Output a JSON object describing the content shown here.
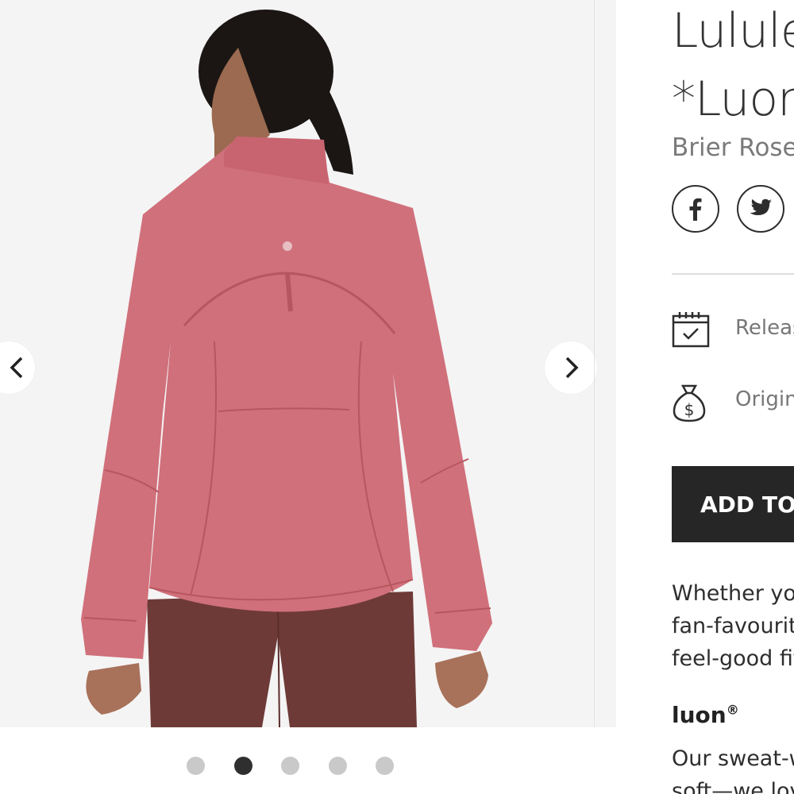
{
  "product": {
    "title_line1": "Lululemon",
    "title_line2": "*Luon",
    "color_name": "Brier Rose"
  },
  "social": {
    "facebook_icon": "facebook-icon",
    "twitter_icon": "twitter-icon"
  },
  "info": {
    "release_label": "Release",
    "original_label": "Original"
  },
  "cart": {
    "add_label": "ADD TO"
  },
  "description": {
    "lines": [
      "Whether you",
      "fan-favourite",
      "feel-good fit"
    ]
  },
  "fabric": {
    "heading": "luon",
    "heading_mark": "®",
    "lines": [
      "Our sweat-w",
      "soft—we lov"
    ]
  },
  "gallery": {
    "total_images": 5,
    "active_index": 1,
    "prev_icon": "chevron-left-icon",
    "next_icon": "chevron-right-icon"
  },
  "colors": {
    "jacket": "#d0707b",
    "leggings": "#6e3a37",
    "button_bg": "#262626"
  }
}
